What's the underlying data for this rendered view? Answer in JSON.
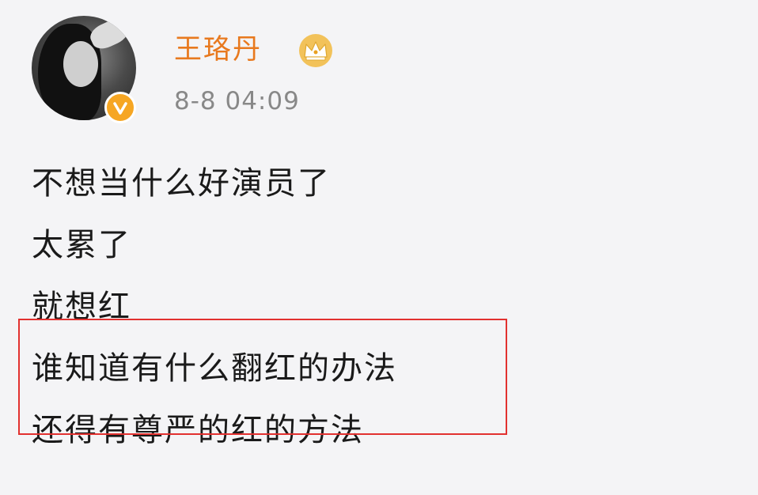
{
  "post": {
    "author": {
      "name": "王珞丹",
      "avatar_icon": "user-avatar",
      "verified_icon": "verified-v-badge",
      "member_icon": "crown-icon"
    },
    "timestamp": "8-8 04:09",
    "lines": [
      "不想当什么好演员了",
      "太累了",
      "就想红",
      "谁知道有什么翻红的办法",
      "还得有尊严的红的方法"
    ],
    "highlighted_line_indices": [
      3,
      4
    ]
  },
  "colors": {
    "name": "#e8791e",
    "timestamp": "#888888",
    "text": "#1a1a1a",
    "highlight_border": "#e2312f",
    "badge": "#f6a623"
  }
}
